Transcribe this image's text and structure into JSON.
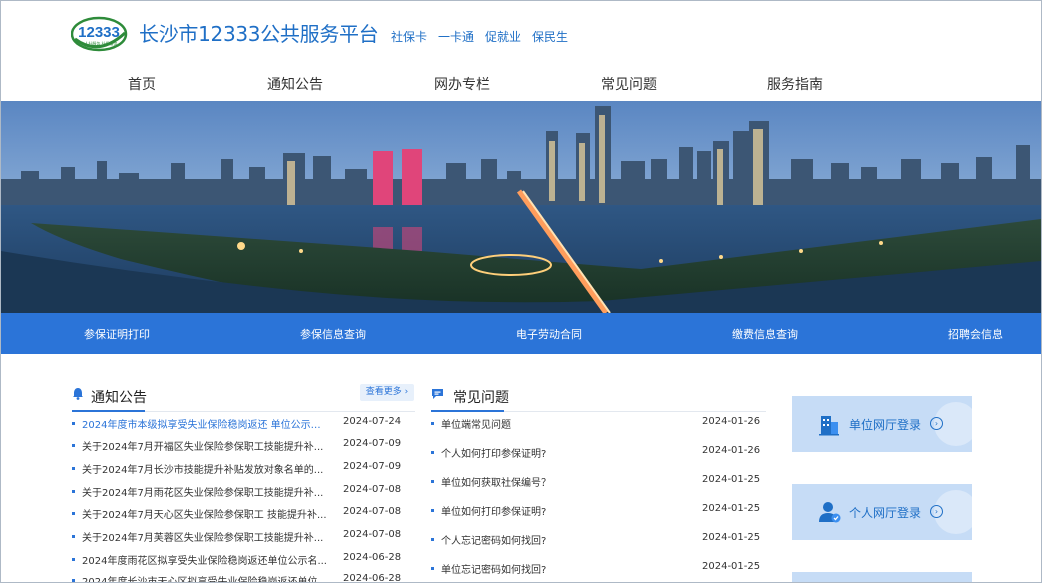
{
  "header": {
    "logo_text": "12333",
    "logo_sub": "人社服务 社保服务",
    "site_title": "长沙市12333公共服务平台",
    "slogans": [
      "社保卡",
      "一卡通",
      "促就业",
      "保民生"
    ]
  },
  "nav": [
    "首页",
    "通知公告",
    "网办专栏",
    "常见问题",
    "服务指南"
  ],
  "quick_links": [
    "参保证明打印",
    "参保信息查询",
    "电子劳动合同",
    "缴费信息查询",
    "招聘会信息"
  ],
  "notices": {
    "title": "通知公告",
    "more": "查看更多",
    "items": [
      {
        "text": "2024年度市本级拟享受失业保险稳岗返还 单位公示名...",
        "date": "2024-07-24"
      },
      {
        "text": "关于2024年7月开福区失业保险参保职工技能提升补...",
        "date": "2024-07-09"
      },
      {
        "text": "关于2024年7月长沙市技能提升补贴发放对象名单的...",
        "date": "2024-07-09"
      },
      {
        "text": "关于2024年7月雨花区失业保险参保职工技能提升补...",
        "date": "2024-07-08"
      },
      {
        "text": "关于2024年7月天心区失业保险参保职工 技能提升补...",
        "date": "2024-07-08"
      },
      {
        "text": "关于2024年7月芙蓉区失业保险参保职工技能提升补...",
        "date": "2024-07-08"
      },
      {
        "text": "2024年度雨花区拟享受失业保险稳岗返还单位公示名...",
        "date": "2024-06-28"
      },
      {
        "text": "2024年度长沙市天心区拟享受失业保险稳岗返还单位...",
        "date": "2024-06-28"
      }
    ]
  },
  "faq": {
    "title": "常见问题",
    "items": [
      {
        "text": "单位端常见问题",
        "date": "2024-01-26"
      },
      {
        "text": "个人如何打印参保证明?",
        "date": "2024-01-26"
      },
      {
        "text": "单位如何获取社保编号？",
        "date": "2024-01-25"
      },
      {
        "text": "单位如何打印参保证明?",
        "date": "2024-01-25"
      },
      {
        "text": "个人忘记密码如何找回?",
        "date": "2024-01-25"
      },
      {
        "text": "单位忘记密码如何找回?",
        "date": "2024-01-25"
      }
    ]
  },
  "logins": [
    {
      "label": "单位网厅登录",
      "icon": "building-icon"
    },
    {
      "label": "个人网厅登录",
      "icon": "user-icon"
    }
  ],
  "colors": {
    "primary": "#2b74d8",
    "title_blue": "#1f6fc6",
    "card_bg": "#c6dcf6"
  }
}
